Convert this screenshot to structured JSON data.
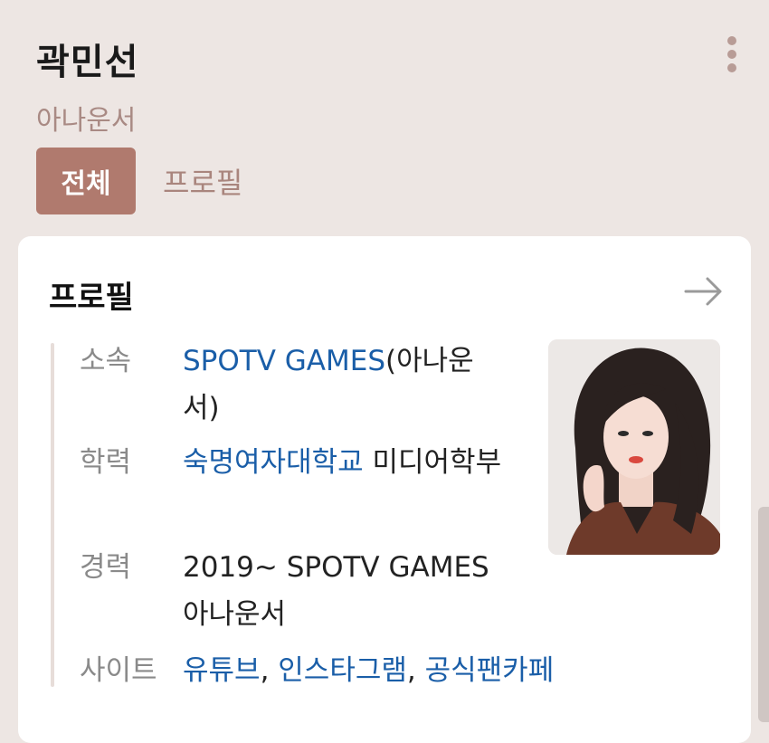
{
  "header": {
    "name": "곽민선",
    "subtitle": "아나운서",
    "more_icon": "more-vertical-icon"
  },
  "tabs": [
    {
      "label": "전체",
      "active": true
    },
    {
      "label": "프로필",
      "active": false
    }
  ],
  "card": {
    "title": "프로필",
    "arrow_icon": "arrow-right-icon",
    "rows": {
      "affiliation": {
        "label": "소속",
        "link": "SPOTV GAMES",
        "text": "(아나운서)"
      },
      "education": {
        "label": "학력",
        "link": "숙명여자대학교",
        "text": " 미디어학부"
      },
      "career": {
        "label": "경력",
        "text": "2019~ SPOTV GAMES 아나운서"
      },
      "site": {
        "label": "사이트",
        "link1": "유튜브",
        "sep1": ", ",
        "link2": "인스타그램",
        "sep2": ", ",
        "link3": "공식팬카페"
      }
    }
  },
  "colors": {
    "background": "#ede6e3",
    "accent": "#b07a6e",
    "link": "#1a5ea8"
  }
}
